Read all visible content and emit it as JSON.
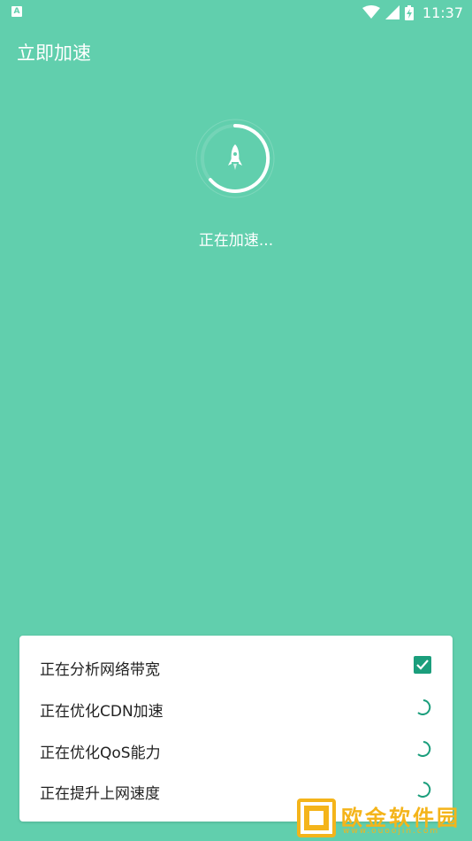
{
  "status_bar": {
    "notification_icon": "a-icon",
    "time": "11:37"
  },
  "header": {
    "title": "立即加速"
  },
  "main": {
    "status_message": "正在加速..."
  },
  "tasks": [
    {
      "label": "正在分析网络带宽",
      "state": "done"
    },
    {
      "label": "正在优化CDN加速",
      "state": "loading"
    },
    {
      "label": "正在优化QoS能力",
      "state": "loading"
    },
    {
      "label": "正在提升上网速度",
      "state": "loading"
    }
  ],
  "watermark": {
    "text": "欧金软件园",
    "url": "www.ouoojin.com"
  },
  "colors": {
    "background": "#61cfad",
    "accent": "#1b9e7c"
  }
}
